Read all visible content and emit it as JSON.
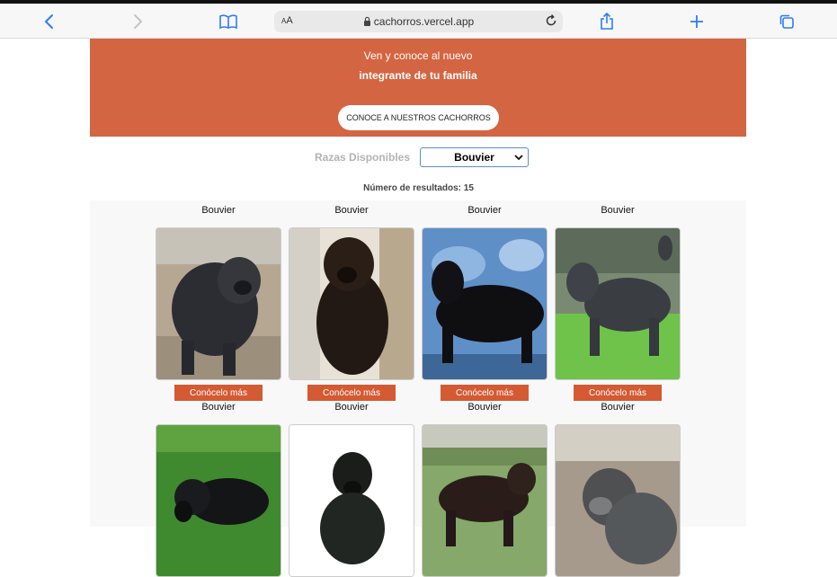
{
  "browser": {
    "url": "cachorros.vercel.app",
    "reader_label": "AA"
  },
  "hero": {
    "line1": "Ven y conoce al nuevo",
    "line2": "integrante de tu familia",
    "cta": "CONOCE A NUESTROS CACHORROS"
  },
  "filter": {
    "label": "Razas Disponibles",
    "selected": "Bouvier"
  },
  "results": {
    "text": "Número de resultados: 15"
  },
  "cards": [
    {
      "name": "Bouvier",
      "button": "Conócelo más"
    },
    {
      "name": "Bouvier",
      "button": "Conócelo más"
    },
    {
      "name": "Bouvier",
      "button": "Conócelo más"
    },
    {
      "name": "Bouvier",
      "button": "Conócelo más"
    },
    {
      "name": "Bouvier"
    },
    {
      "name": "Bouvier"
    },
    {
      "name": "Bouvier"
    },
    {
      "name": "Bouvier"
    }
  ],
  "colors": {
    "hero_bg": "#d46542",
    "button_bg": "#d45a33",
    "ios_blue": "#2f7bf5"
  }
}
